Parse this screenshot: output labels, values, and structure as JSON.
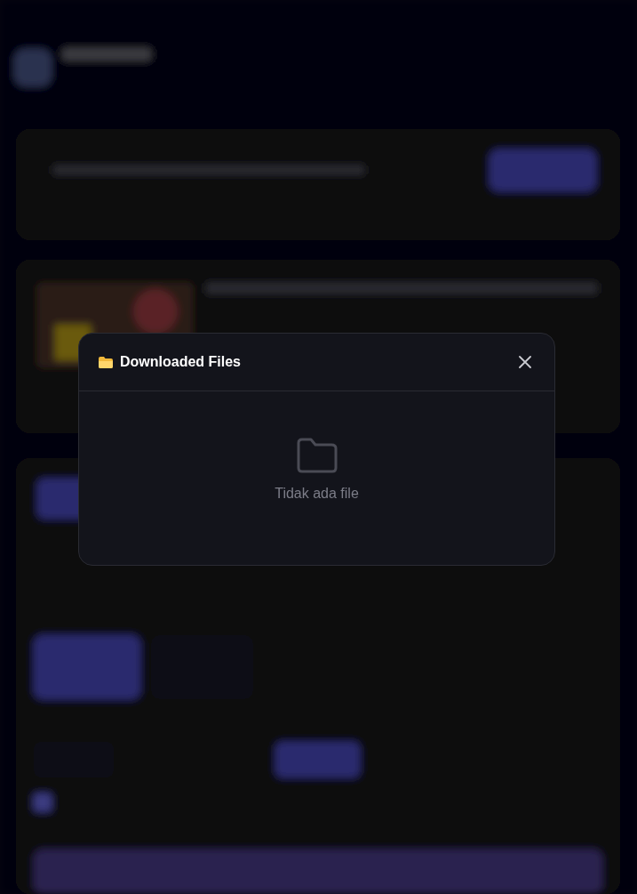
{
  "dialog": {
    "title": "Downloaded Files",
    "empty_message": "Tidak ada file"
  }
}
